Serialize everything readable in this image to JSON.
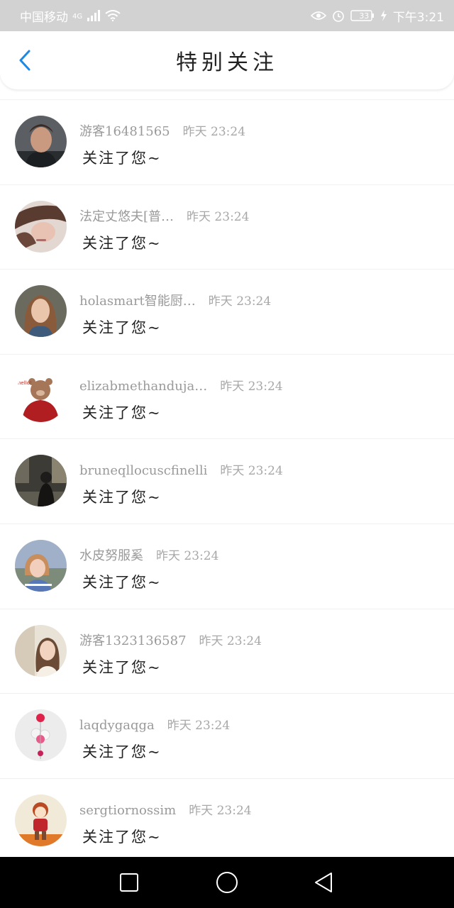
{
  "status_bar": {
    "carrier": "中国移动",
    "network": "4G",
    "battery": "33",
    "time": "下午3:21",
    "icons": [
      "signal-icon",
      "wifi-icon",
      "eye-icon",
      "alarm-icon",
      "battery-icon",
      "charging-icon"
    ]
  },
  "header": {
    "title": "特别关注",
    "back_icon": "chevron-left-icon",
    "accent_color": "#1E88E5"
  },
  "follows": [
    {
      "name": "游客16481565",
      "time": "昨天 23:24",
      "message": "关注了您~",
      "avatar": "avatar-man-hoodie"
    },
    {
      "name": "法定丈悠夫[普…",
      "time": "昨天 23:24",
      "message": "关注了您~",
      "avatar": "avatar-woman-lying"
    },
    {
      "name": "holasmart智能厨…",
      "time": "昨天 23:24",
      "message": "关注了您~",
      "avatar": "avatar-woman-portrait"
    },
    {
      "name": "elizabmethanduja…",
      "time": "昨天 23:24",
      "message": "关注了您~",
      "avatar": "avatar-teddy-bear"
    },
    {
      "name": "bruneqllocuscfinelli",
      "time": "昨天 23:24",
      "message": "关注了您~",
      "avatar": "avatar-man-street"
    },
    {
      "name": "水皮努服奚",
      "time": "昨天 23:24",
      "message": "关注了您~",
      "avatar": "avatar-girl-outdoor"
    },
    {
      "name": "游客1323136587",
      "time": "昨天 23:24",
      "message": "关注了您~",
      "avatar": "avatar-girl-window"
    },
    {
      "name": "laqdygaqga",
      "time": "昨天 23:24",
      "message": "关注了您~",
      "avatar": "avatar-balloons"
    },
    {
      "name": "sergtiornossim",
      "time": "昨天 23:24",
      "message": "关注了您~",
      "avatar": "avatar-cartoon-girl"
    }
  ],
  "nav_bar": {
    "icons": [
      "recent-apps-icon",
      "home-icon",
      "back-triangle-icon"
    ]
  }
}
